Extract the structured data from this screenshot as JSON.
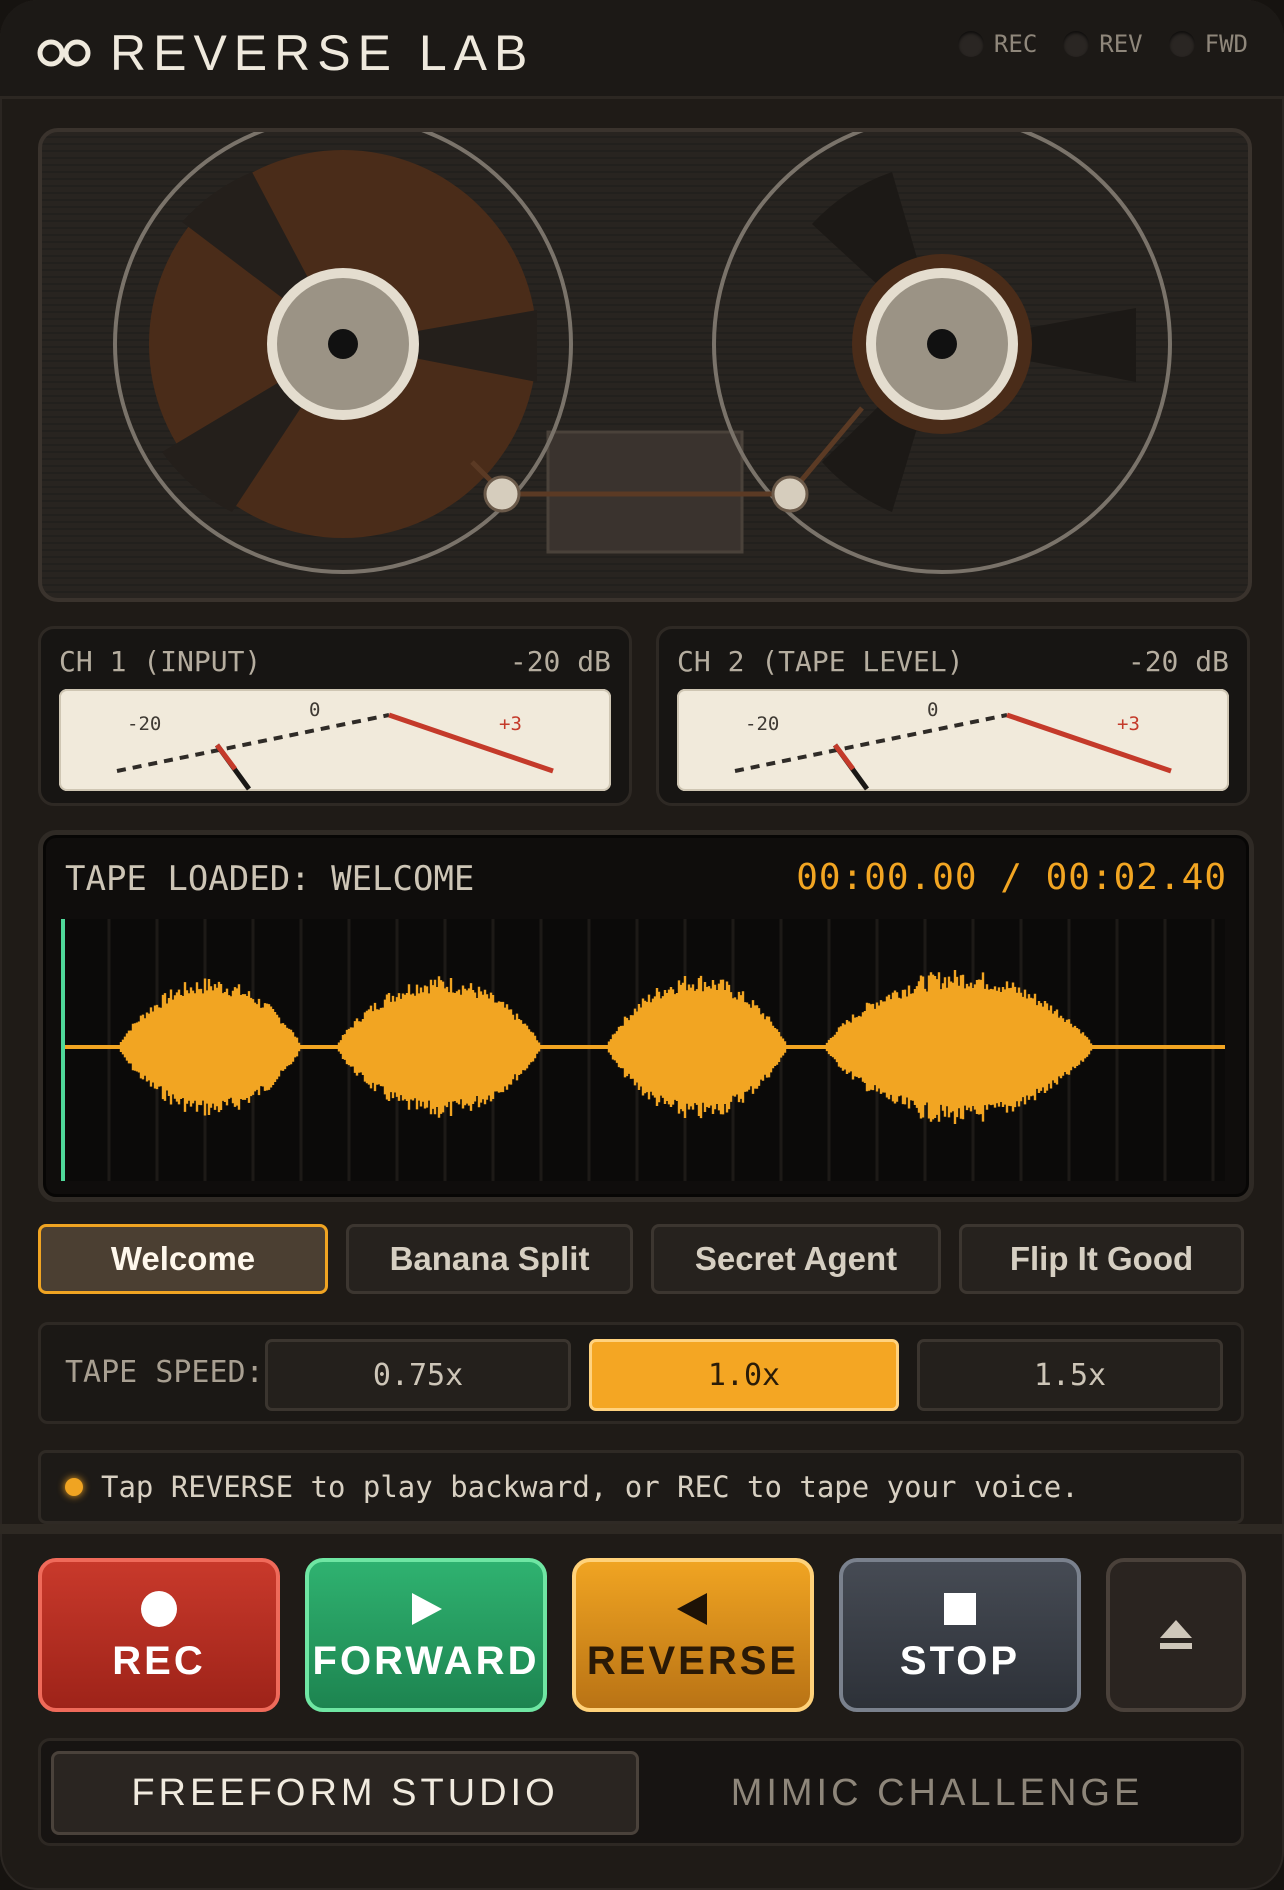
{
  "app": {
    "title": "REVERSE LAB",
    "logo_icon": "infinity-reel-icon",
    "indicators": [
      {
        "label": "REC",
        "lit": false
      },
      {
        "label": "REV",
        "lit": false
      },
      {
        "label": "FWD",
        "lit": false
      }
    ]
  },
  "meters": [
    {
      "label": "CH 1 (INPUT)",
      "level": "-20 dB",
      "scale": [
        "-20",
        "0",
        "+3"
      ]
    },
    {
      "label": "CH 2 (TAPE LEVEL)",
      "level": "-20 dB",
      "scale": [
        "-20",
        "0",
        "+3"
      ]
    }
  ],
  "screen": {
    "tape_loaded": "TAPE LOADED: WELCOME",
    "timecode": "00:00.00 / 00:02.40",
    "playhead_fraction": 0
  },
  "tapes": [
    {
      "label": "Welcome",
      "active": true
    },
    {
      "label": "Banana Split",
      "active": false
    },
    {
      "label": "Secret Agent",
      "active": false
    },
    {
      "label": "Flip It Good",
      "active": false
    }
  ],
  "speed": {
    "label": "TAPE SPEED:",
    "options": [
      "0.75x",
      "1.0x",
      "1.5x"
    ],
    "selected": "1.0x"
  },
  "hint": "Tap REVERSE to play backward, or REC to tape your voice.",
  "transport": {
    "rec": "REC",
    "forward": "FORWARD",
    "reverse": "REVERSE",
    "stop": "STOP",
    "eject_icon": "eject-icon"
  },
  "modes": {
    "freeform": "FREEFORM STUDIO",
    "mimic": "MIMIC CHALLENGE",
    "active": "freeform"
  },
  "colors": {
    "accent": "#f2a522",
    "rec": "#c8392b",
    "forward": "#2fb270",
    "stop": "#3a3f47",
    "background": "#1f1b17"
  }
}
